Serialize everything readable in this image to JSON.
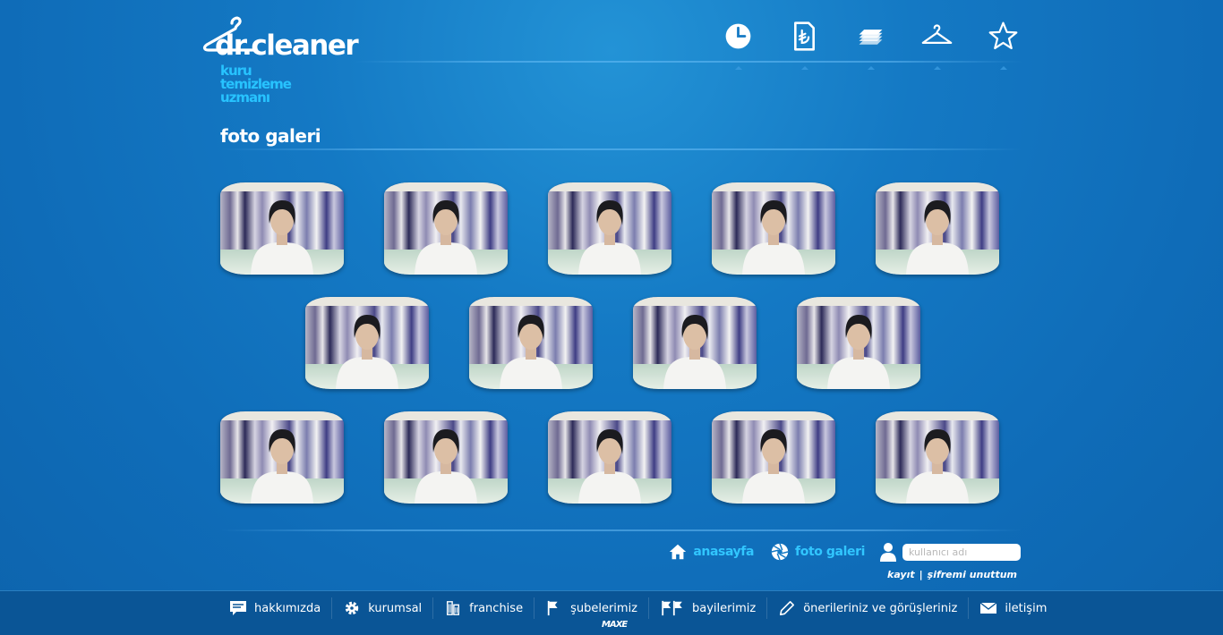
{
  "brand": {
    "name": "dr.cleaner",
    "tagline": [
      "kuru",
      "temizleme",
      "uzmanı"
    ]
  },
  "top_icons": [
    {
      "name": "clock-icon"
    },
    {
      "name": "lira-document-icon"
    },
    {
      "name": "stacked-cloths-icon"
    },
    {
      "name": "hanger-icon"
    },
    {
      "name": "star-icon"
    }
  ],
  "page_title": "foto galeri",
  "gallery": {
    "rows": [
      5,
      4,
      5
    ]
  },
  "quick_links": {
    "home": "anasayfa",
    "gallery": "foto galeri"
  },
  "login": {
    "username_placeholder": "kullanıcı adı",
    "register": "kayıt",
    "separator": "|",
    "forgot": "şifremi unuttum"
  },
  "nav": [
    {
      "label": "hakkımızda",
      "icon": "speech-bubble-icon"
    },
    {
      "label": "kurumsal",
      "icon": "gear-icon"
    },
    {
      "label": "franchise",
      "icon": "building-icon"
    },
    {
      "label": "şubelerimiz",
      "icon": "flag-icon"
    },
    {
      "label": "bayilerimiz",
      "icon": "double-flag-icon"
    },
    {
      "label": "önerileriniz ve görüşleriniz",
      "icon": "pencil-icon"
    },
    {
      "label": "iletişim",
      "icon": "envelope-icon"
    }
  ],
  "credit": "MAXE",
  "colors": {
    "accent": "#31c6ff",
    "background": "#1479c4",
    "bar": "#0a5596"
  }
}
